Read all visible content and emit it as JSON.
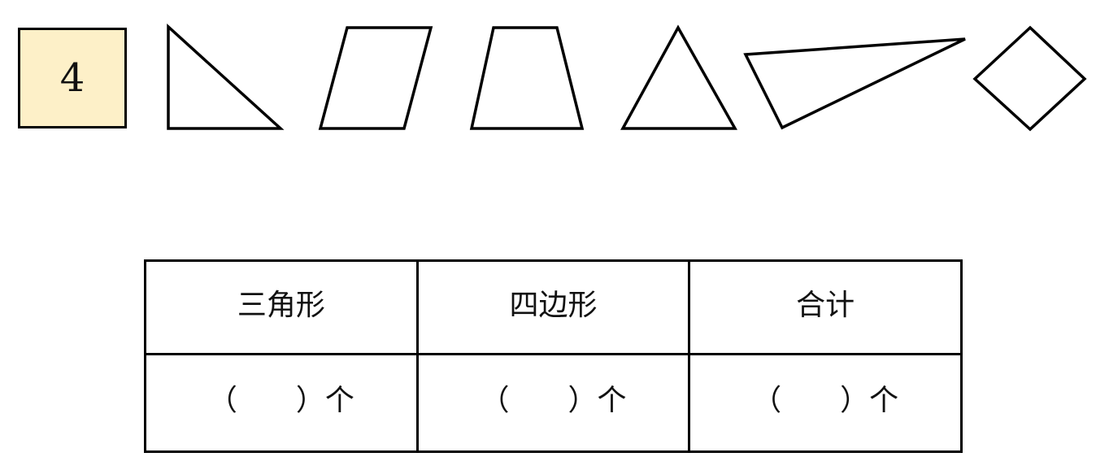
{
  "problem": {
    "number": "4",
    "badge_color": "#fdf0c8"
  },
  "shapes": [
    {
      "name": "right-triangle",
      "kind": "triangle"
    },
    {
      "name": "parallelogram",
      "kind": "quadrilateral"
    },
    {
      "name": "trapezoid",
      "kind": "quadrilateral"
    },
    {
      "name": "isosceles-triangle",
      "kind": "triangle"
    },
    {
      "name": "obtuse-triangle",
      "kind": "triangle"
    },
    {
      "name": "rhombus",
      "kind": "quadrilateral"
    }
  ],
  "table": {
    "headers": [
      "三角形",
      "四边形",
      "合计"
    ],
    "answers": [
      "（　　）个",
      "（　　）个",
      "（　　）个"
    ]
  }
}
